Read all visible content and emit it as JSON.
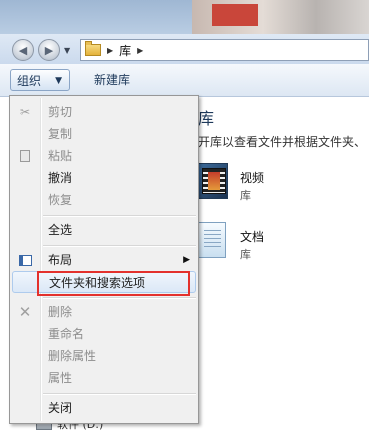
{
  "address": {
    "path": [
      "库"
    ]
  },
  "toolbar": {
    "organize_label": "组织",
    "new_library_label": "新建库"
  },
  "content": {
    "heading_fragment": "库",
    "description": "开库以查看文件并根据文件夹、",
    "items": [
      {
        "name": "视频",
        "type": "库",
        "icon": "video-library-icon"
      },
      {
        "name": "文档",
        "type": "库",
        "icon": "document-library-icon"
      }
    ]
  },
  "nav": {
    "bottom_item_label": "软件 (D:)"
  },
  "menu": {
    "items": [
      {
        "label": "剪切",
        "enabled": false,
        "icon": "scissors-icon"
      },
      {
        "label": "复制",
        "enabled": false,
        "icon": ""
      },
      {
        "label": "粘贴",
        "enabled": false,
        "icon": "paste-icon"
      },
      {
        "label": "撤消",
        "enabled": true,
        "icon": ""
      },
      {
        "label": "恢复",
        "enabled": false,
        "icon": ""
      },
      {
        "label": "全选",
        "enabled": true,
        "icon": ""
      },
      {
        "label": "布局",
        "enabled": true,
        "icon": "layout-icon",
        "submenu": true
      },
      {
        "label": "文件夹和搜索选项",
        "enabled": true,
        "icon": "",
        "highlighted": true
      },
      {
        "label": "删除",
        "enabled": false,
        "icon": "delete-x-icon"
      },
      {
        "label": "重命名",
        "enabled": false,
        "icon": ""
      },
      {
        "label": "删除属性",
        "enabled": false,
        "icon": ""
      },
      {
        "label": "属性",
        "enabled": false,
        "icon": ""
      },
      {
        "label": "关闭",
        "enabled": true,
        "icon": ""
      }
    ]
  },
  "colors": {
    "highlight_border": "#e3312d",
    "toolbar_text": "#1e395b"
  }
}
